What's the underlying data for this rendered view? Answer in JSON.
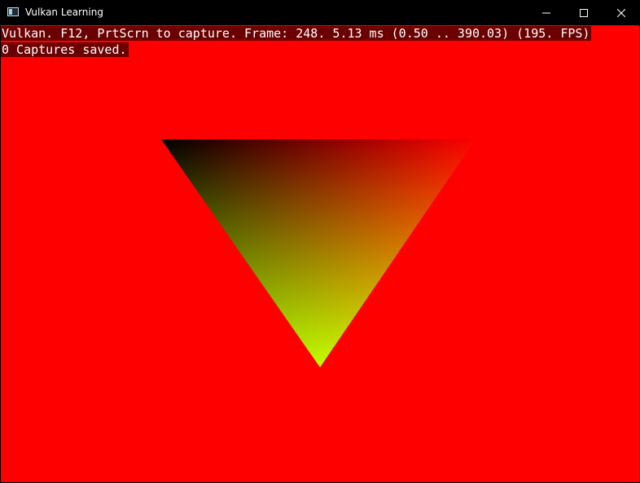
{
  "window": {
    "title": "Vulkan Learning",
    "app_icon": "window-app-icon",
    "controls": {
      "minimize_icon": "minimize-icon",
      "maximize_icon": "maximize-icon",
      "close_icon": "close-icon"
    }
  },
  "overlay": {
    "stats_line": "Vulkan. F12, PrtScrn to capture. Frame: 248. 5.13 ms (0.50 .. 390.03) (195. FPS)",
    "captures_line": "0 Captures saved."
  },
  "scene": {
    "clear_color": "#ff0000",
    "triangle_colors": {
      "top_left": "#000000",
      "top_right": "#ff0000",
      "bottom": "#80ff00"
    }
  }
}
